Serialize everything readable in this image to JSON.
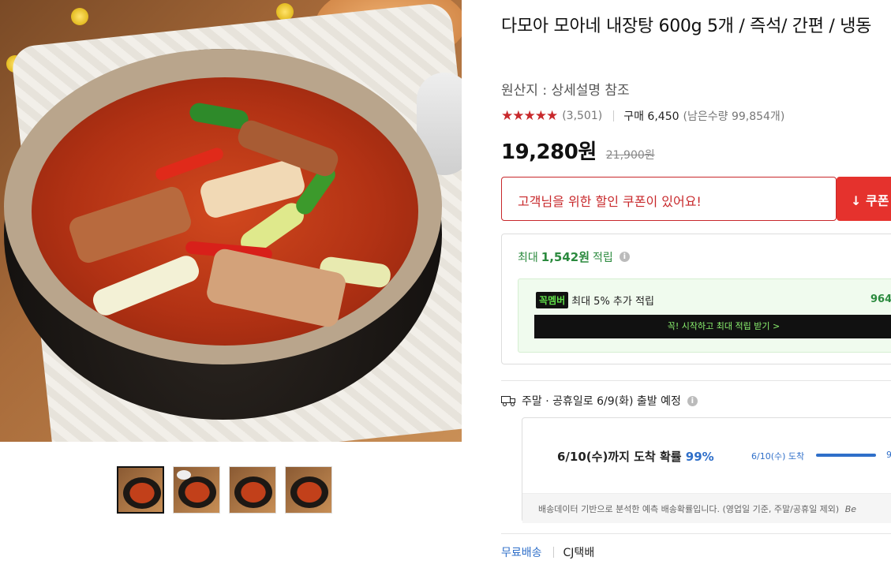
{
  "product": {
    "title": "다모아 모아네 내장탕 600g 5개 / 즉석/ 간편 / 냉동",
    "origin": "원산지 : 상세설명 참조",
    "stars": "★★★★★",
    "review_count": "(3,501)",
    "purchase_label": "구매 6,450",
    "remaining": "(남은수량 99,854개)",
    "price": "19,280원",
    "original_price": "21,900원"
  },
  "coupon": {
    "message": "고객님을 위한 할인 쿠폰이 있어요!",
    "button_label": "쿠폰"
  },
  "points": {
    "prefix": "최대",
    "amount": "1,542원",
    "suffix": "적립",
    "info_icon": "i",
    "member_badge": "꼭멤버",
    "member_text": "최대 5% 추가 적립",
    "member_points": "964",
    "member_cta": "꼭! 시작하고 최대 적립 받기 >"
  },
  "shipping": {
    "notice": "주말 · 공휴일로 6/9(화) 출발 예정",
    "arrival_main_text": "6/10(수)까지 도착 확률",
    "arrival_pct": "99%",
    "arrival_date_label": "6/10(수) 도착",
    "arrival_bar_value": "9",
    "arrival_progress": 0.99,
    "footnote": "배송데이터 기반으로 분석한 예측 배송확률입니다. (영업일 기준, 주말/공휴일 제외)",
    "footnote_trailing": "Be",
    "free_shipping": "무료배송",
    "courier": "CJ택배"
  },
  "icons": {
    "truck": "truck-icon",
    "info": "info-icon",
    "download": "download-icon"
  },
  "colors": {
    "accent_red": "#c8282b",
    "coupon_button": "#e5322d",
    "points_green": "#2b8a3e",
    "arrival_blue": "#2f6fc9"
  }
}
